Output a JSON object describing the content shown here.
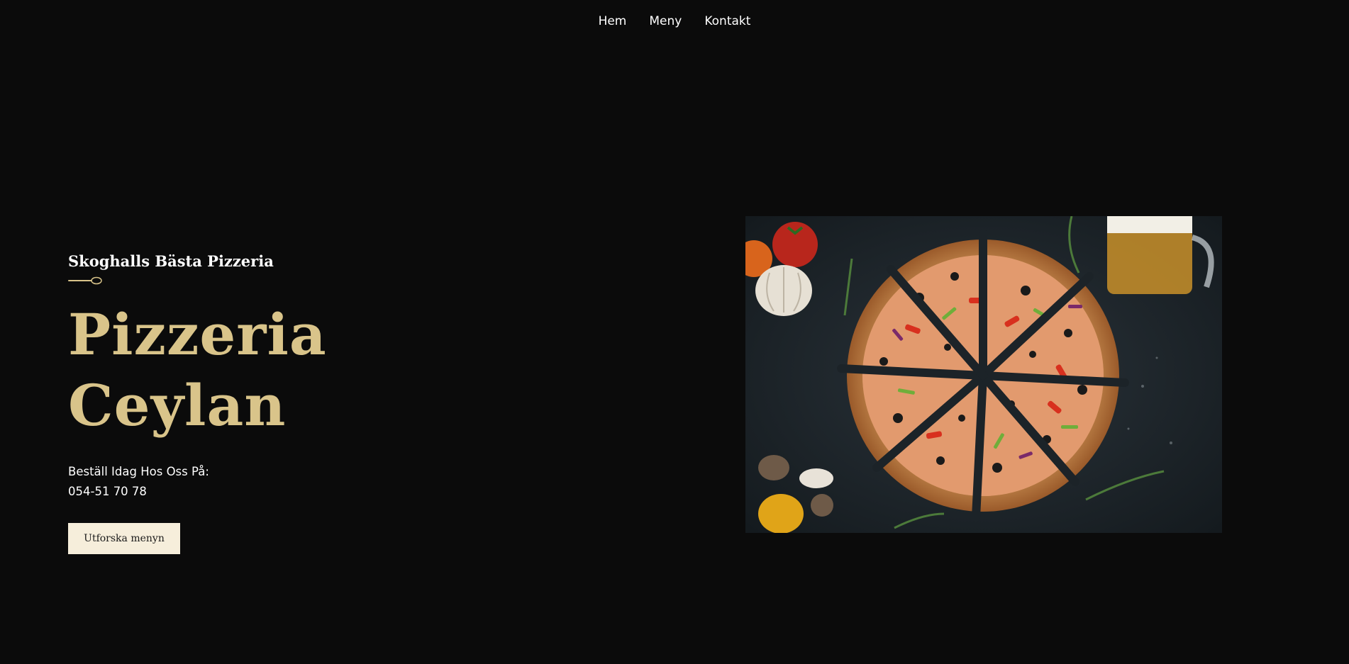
{
  "nav": {
    "items": [
      {
        "label": "Hem"
      },
      {
        "label": "Meny"
      },
      {
        "label": "Kontakt"
      }
    ]
  },
  "hero": {
    "subtitle": "Skoghalls Bästa Pizzeria",
    "title": "Pizzeria Ceylan",
    "order_line1": "Beställ Idag Hos Oss På:",
    "phone": "054-51 70 78",
    "cta_label": "Utforska menyn"
  },
  "colors": {
    "background": "#0b0b0b",
    "title_gold": "#d9c48a",
    "button_bg": "#f6eedb",
    "text": "#ffffff"
  },
  "icons": {
    "divider": "spoon-icon"
  }
}
